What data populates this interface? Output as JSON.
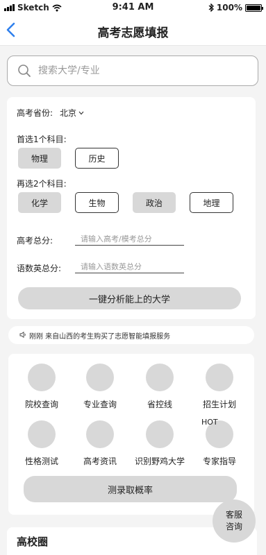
{
  "status_bar": {
    "carrier": "Sketch",
    "time": "9:41 AM",
    "battery": "100%",
    "battery_level": 1.0
  },
  "nav": {
    "title": "高考志愿填报"
  },
  "search": {
    "placeholder": "搜索大学/专业"
  },
  "form": {
    "province_label": "高考省份:",
    "province_value": "北京",
    "first_subject_label": "首选1个科目:",
    "first_subjects": [
      {
        "label": "物理",
        "selected": true
      },
      {
        "label": "历史",
        "selected": false
      }
    ],
    "second_subject_label": "再选2个科目:",
    "second_subjects": [
      {
        "label": "化学",
        "selected": true
      },
      {
        "label": "生物",
        "selected": false
      },
      {
        "label": "政治",
        "selected": true
      },
      {
        "label": "地理",
        "selected": false
      }
    ],
    "total_score_label": "高考总分:",
    "total_score_placeholder": "请输入高考/模考总分",
    "core_score_label": "语数英总分:",
    "core_score_placeholder": "请输入语数英总分",
    "analyze_button": "一键分析能上的大学"
  },
  "ticker": {
    "text": "刚刚 来自山西的考生购买了志愿智能填报服务"
  },
  "tools": {
    "items": [
      {
        "label": "院校查询"
      },
      {
        "label": "专业查询"
      },
      {
        "label": "省控线"
      },
      {
        "label": "招生计划"
      },
      {
        "label": "性格测试"
      },
      {
        "label": "高考资讯"
      },
      {
        "label": "识别野鸡大学"
      },
      {
        "label": "专家指导"
      }
    ],
    "hot_badge": "HOT",
    "probability_button": "测录取概率"
  },
  "campus": {
    "title": "高校圈"
  },
  "customer_service": {
    "line1": "客服",
    "line2": "咨询"
  }
}
